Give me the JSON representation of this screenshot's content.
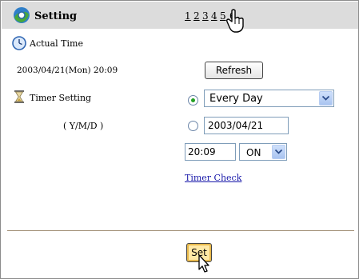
{
  "header": {
    "title": "Setting",
    "icon": "setting-icon",
    "pages": [
      "1",
      "2",
      "3",
      "4",
      "5",
      "6"
    ],
    "current_page": "6"
  },
  "actual_time": {
    "label": "Actual Time",
    "icon": "clock-icon",
    "value": "2003/04/21(Mon) 20:09",
    "refresh_label": "Refresh"
  },
  "timer": {
    "label": "Timer Setting",
    "icon": "hourglass-icon",
    "date_format_label": "( Y/M/D )",
    "mode_selected": "every-day",
    "every_day_option": "Every Day",
    "date_value": "2003/04/21",
    "time_value": "20:09",
    "on_off_value": "ON",
    "timer_check_label": "Timer Check"
  },
  "footer": {
    "set_label": "Set"
  },
  "colors": {
    "header_bg": "#dcdcdc",
    "link": "#1a1aaa",
    "set_button": "#ffe9a6",
    "divider": "#a4927a"
  }
}
